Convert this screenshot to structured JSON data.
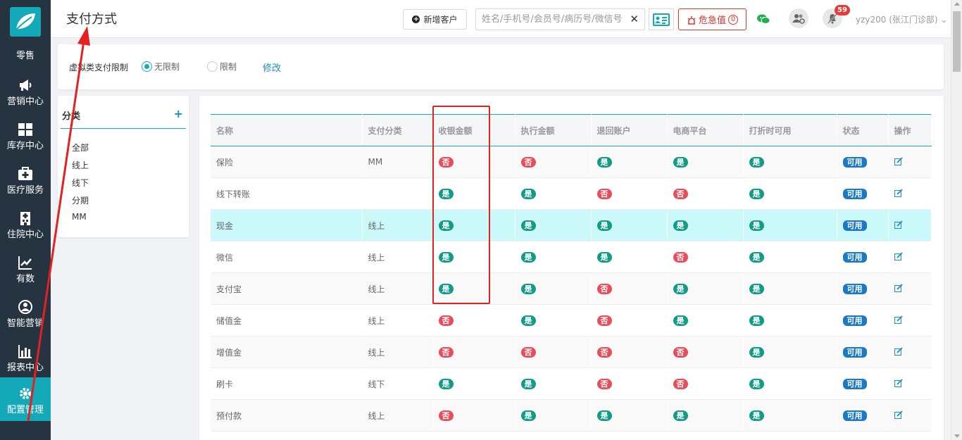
{
  "sidebar": {
    "retail": "零售",
    "items": [
      {
        "label": "营销中心"
      },
      {
        "label": "库存中心"
      },
      {
        "label": "医疗服务"
      },
      {
        "label": "住院中心"
      },
      {
        "label": "有数"
      },
      {
        "label": "智能营销"
      },
      {
        "label": "报表中心"
      },
      {
        "label": "配置管理"
      }
    ],
    "active": "配置管理"
  },
  "header": {
    "title": "支付方式",
    "new_customer": "新增客户",
    "search_placeholder": "姓名/手机号/会员号/病历号/微信号",
    "clear_glyph": "✕",
    "danger_label": "危急值",
    "danger_count": "0",
    "notification_count": "59",
    "user": "yzy200 (张江门诊部)"
  },
  "limit_panel": {
    "label": "虚拟类支付限制",
    "option_unlimited": "无限制",
    "option_limited": "限制",
    "selected": "无限制",
    "edit_link": "修改"
  },
  "category": {
    "title": "分类",
    "add_glyph": "+",
    "items": [
      "全部",
      "线上",
      "线下",
      "分期",
      "MM"
    ]
  },
  "table": {
    "headers": [
      "名称",
      "支付分类",
      "收银金额",
      "执行金额",
      "退回账户",
      "电商平台",
      "打折时可用",
      "状态",
      "操作"
    ],
    "rows": [
      {
        "name": "保险",
        "category": "MM",
        "cashier": "否",
        "exec": "否",
        "refund": "是",
        "ecommerce": "是",
        "discount": "是",
        "status": "可用"
      },
      {
        "name": "线下转账",
        "category": "",
        "cashier": "是",
        "exec": "是",
        "refund": "否",
        "ecommerce": "否",
        "discount": "是",
        "status": "可用"
      },
      {
        "name": "现金",
        "category": "线上",
        "cashier": "是",
        "exec": "是",
        "refund": "是",
        "ecommerce": "是",
        "discount": "是",
        "status": "可用"
      },
      {
        "name": "微信",
        "category": "线上",
        "cashier": "是",
        "exec": "是",
        "refund": "是",
        "ecommerce": "否",
        "discount": "是",
        "status": "可用"
      },
      {
        "name": "支付宝",
        "category": "线上",
        "cashier": "是",
        "exec": "是",
        "refund": "否",
        "ecommerce": "是",
        "discount": "是",
        "status": "可用"
      },
      {
        "name": "储值金",
        "category": "线上",
        "cashier": "否",
        "exec": "是",
        "refund": "否",
        "ecommerce": "是",
        "discount": "是",
        "status": "可用"
      },
      {
        "name": "增值金",
        "category": "线上",
        "cashier": "否",
        "exec": "否",
        "refund": "否",
        "ecommerce": "否",
        "discount": "是",
        "status": "可用"
      },
      {
        "name": "刷卡",
        "category": "线下",
        "cashier": "是",
        "exec": "是",
        "refund": "否",
        "ecommerce": "否",
        "discount": "是",
        "status": "可用"
      },
      {
        "name": "预付款",
        "category": "线上",
        "cashier": "否",
        "exec": "是",
        "refund": "是",
        "ecommerce": "是",
        "discount": "是",
        "status": "可用"
      }
    ],
    "highlighted_row": "现金"
  },
  "colors": {
    "sidebar_bg": "#263341",
    "accent": "#14a9b8",
    "yes": "#129b86",
    "no": "#ea4d5a",
    "available": "#1b7ac3",
    "highlight_row": "#cbf9f9",
    "annotation": "#e52020"
  },
  "icons": {
    "logo": "leaf-logo-icon",
    "retail": "none",
    "marketing": "megaphone-icon",
    "inventory": "grid-icon",
    "medical": "medical-kit-icon",
    "inpatient": "hospital-building-icon",
    "analytics": "trend-line-icon",
    "smart_marketing": "people-circle-icon",
    "reports": "bar-chart-icon",
    "config": "gear-icon"
  }
}
